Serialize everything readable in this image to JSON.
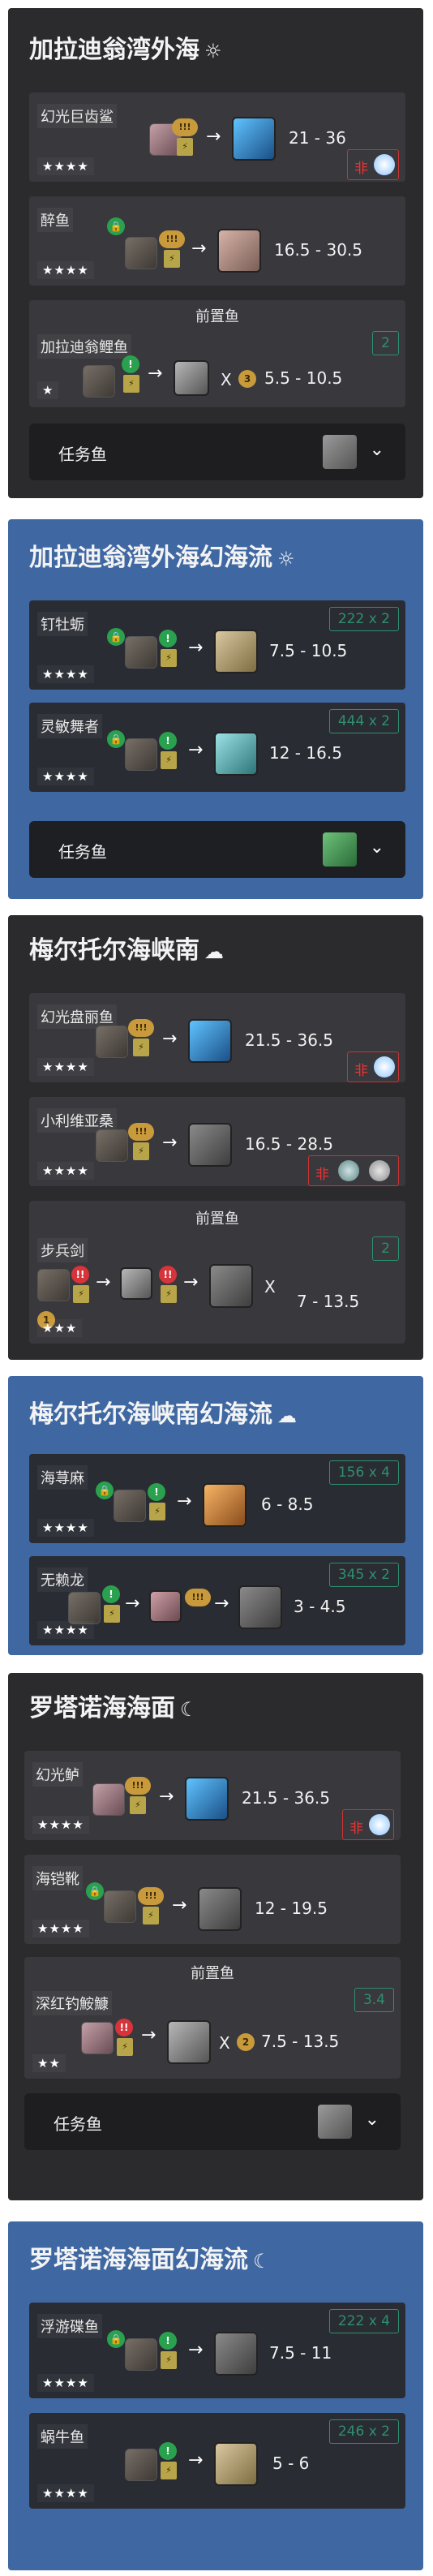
{
  "sections": [
    {
      "title": "加拉迪翁湾外海",
      "weather_icon": "☼",
      "fish": [
        {
          "name": "幻光巨齿鲨",
          "stars": "★★★★",
          "hook": "!!!",
          "range": "21 - 36",
          "fei": "非"
        },
        {
          "name": "醉鱼",
          "stars": "★★★★",
          "hook": "!!!",
          "range": "16.5 - 30.5"
        }
      ],
      "prereq_title": "前置鱼",
      "prereq": [
        {
          "name": "加拉迪翁鲤鱼",
          "stars": "★",
          "count": "2",
          "mult": "X",
          "mult_num": "3",
          "range": "5.5 - 10.5"
        }
      ],
      "task_label": "任务鱼"
    },
    {
      "title": "加拉迪翁湾外海幻海流",
      "weather_icon": "☼",
      "fish": [
        {
          "name": "钉牡蛎",
          "stars": "★★★★",
          "count": "222 x 2",
          "range": "7.5 - 10.5"
        },
        {
          "name": "灵敏舞者",
          "stars": "★★★★",
          "count": "444 x 2",
          "range": "12 - 16.5"
        }
      ],
      "task_label": "任务鱼"
    },
    {
      "title": "梅尔托尔海峡南",
      "weather_icon": "☁",
      "fish": [
        {
          "name": "幻光盘丽鱼",
          "stars": "★★★★",
          "hook": "!!!",
          "range": "21.5 - 36.5",
          "fei": "非"
        },
        {
          "name": "小利维亚桑",
          "stars": "★★★★",
          "hook": "!!!",
          "range": "16.5 - 28.5",
          "fei": "非"
        }
      ],
      "prereq_title": "前置鱼",
      "prereq": [
        {
          "name": "步兵剑",
          "stars": "★★★",
          "count": "2",
          "mult": "X",
          "range": "7 - 13.5",
          "mult_num": "1"
        }
      ]
    },
    {
      "title": "梅尔托尔海峡南幻海流",
      "weather_icon": "☁",
      "fish": [
        {
          "name": "海荨麻",
          "stars": "★★★★",
          "count": "156 x 4",
          "range": "6 - 8.5"
        },
        {
          "name": "无赖龙",
          "stars": "★★★★",
          "count": "345 x 2",
          "hook": "!!!",
          "range": "3 - 4.5"
        }
      ]
    },
    {
      "title": "罗塔诺海海面",
      "weather_icon": "☾",
      "fish": [
        {
          "name": "幻光鲈",
          "stars": "★★★★",
          "hook": "!!!",
          "range": "21.5 - 36.5",
          "fei": "非"
        },
        {
          "name": "海铠靴",
          "stars": "★★★★",
          "hook": "!!!",
          "range": "12 - 19.5"
        }
      ],
      "prereq_title": "前置鱼",
      "prereq": [
        {
          "name": "深红钓鮟鱇",
          "stars": "★★",
          "count": "3.4",
          "mult": "X",
          "mult_num": "2",
          "range": "7.5 - 13.5"
        }
      ],
      "task_label": "任务鱼"
    },
    {
      "title": "罗塔诺海海面幻海流",
      "weather_icon": "☾",
      "fish": [
        {
          "name": "浮游碟鱼",
          "stars": "★★★★",
          "count": "222 x 4",
          "range": "7.5 - 11"
        },
        {
          "name": "蜗牛鱼",
          "stars": "★★★★",
          "count": "246 x 2",
          "range": "5 - 6"
        }
      ]
    }
  ],
  "colors": {
    "dark_panel": "#2b2b2e",
    "blue_panel": "#3f68a3",
    "accent_green": "#2e8f6e",
    "warn_red": "#d6343a",
    "gold": "#c99a3c"
  }
}
